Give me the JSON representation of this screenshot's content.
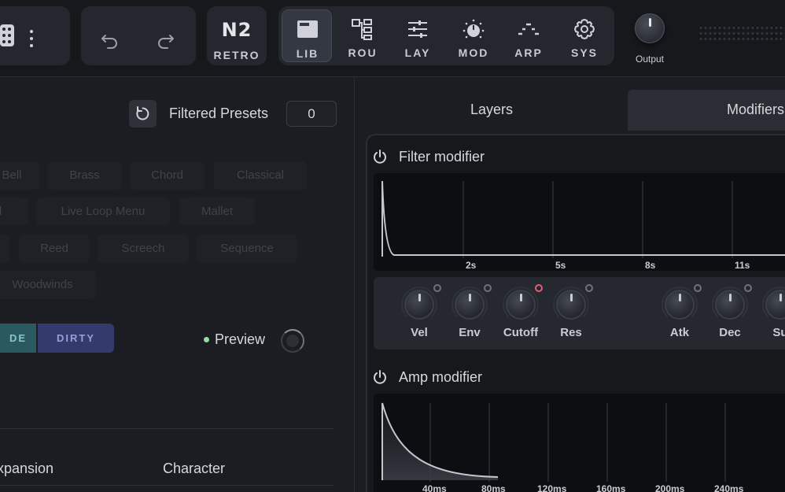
{
  "toolbar": {
    "dice_icon": "dice-icon",
    "more_icon": "more-vertical-icon",
    "undo_icon": "undo-icon",
    "redo_icon": "redo-icon",
    "logo_main": "N2",
    "logo_sub": "RETRO",
    "nav": [
      {
        "label": "LIB",
        "icon": "library-icon",
        "active": true
      },
      {
        "label": "ROU",
        "icon": "routing-icon",
        "active": false
      },
      {
        "label": "LAY",
        "icon": "layers-sliders-icon",
        "active": false
      },
      {
        "label": "MOD",
        "icon": "mod-knob-icon",
        "active": false
      },
      {
        "label": "ARP",
        "icon": "arp-icon",
        "active": false
      },
      {
        "label": "SYS",
        "icon": "settings-gear-icon",
        "active": false
      }
    ],
    "output_label": "Output"
  },
  "library": {
    "filtered_label": "Filtered Presets",
    "filtered_count": "0",
    "tags": [
      "Bell",
      "Brass",
      "Chord",
      "Classical",
      "d",
      "Live Loop Menu",
      "Mallet",
      "Reed",
      "Screech",
      "Sequence",
      "Woodwinds"
    ],
    "segment_a": "DE",
    "segment_b": "DIRTY",
    "preview_label": "Preview",
    "columns": [
      "xpansion",
      "Character"
    ]
  },
  "modifiers": {
    "tabs": [
      "Layers",
      "Modifiers"
    ],
    "filter": {
      "title": "Filter modifier",
      "ticks": [
        "2s",
        "5s",
        "8s",
        "11s"
      ],
      "knobs": [
        "Vel",
        "Env",
        "Cutoff",
        "Res",
        "Atk",
        "Dec",
        "Su"
      ]
    },
    "amp": {
      "title": "Amp modifier",
      "ticks": [
        "40ms",
        "80ms",
        "120ms",
        "160ms",
        "200ms",
        "240ms"
      ]
    }
  },
  "colors": {
    "accent_hot": "#e0607a",
    "preview_dot": "#8fe09a",
    "segment_a": "#2a5a60",
    "segment_b": "#343a6b"
  }
}
